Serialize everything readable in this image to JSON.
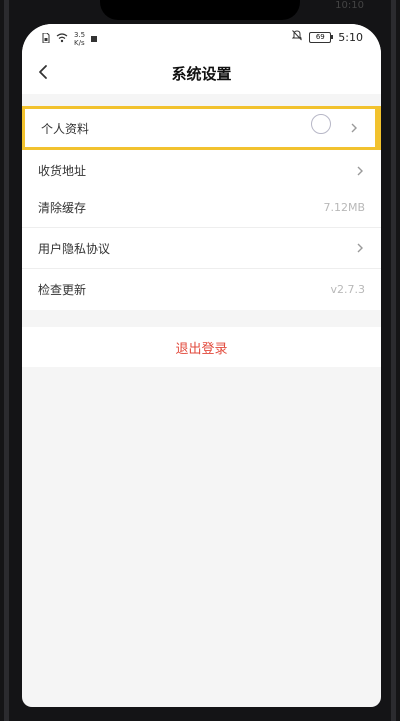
{
  "status_bar": {
    "speed_value": "3.5",
    "speed_unit": "K/s",
    "battery_level": "69",
    "time": "5:10"
  },
  "device_corner_time": "10:10",
  "header": {
    "title": "系统设置"
  },
  "groups": [
    {
      "items": [
        {
          "label": "个人资料",
          "highlighted": true
        },
        {
          "label": "收货地址"
        }
      ]
    },
    {
      "items": [
        {
          "label": "清除缓存",
          "value": "7.12MB"
        },
        {
          "label": "用户隐私协议"
        },
        {
          "label": "检查更新",
          "value": "v2.7.3"
        }
      ]
    }
  ],
  "logout_label": "退出登录",
  "colors": {
    "highlight_border": "#f2c22e",
    "logout_text": "#e24a3c",
    "background": "#f5f5f5"
  },
  "icons": [
    "sim-icon",
    "wifi-icon",
    "mute-icon",
    "battery-icon",
    "back-arrow-icon",
    "chevron-right-icon"
  ]
}
